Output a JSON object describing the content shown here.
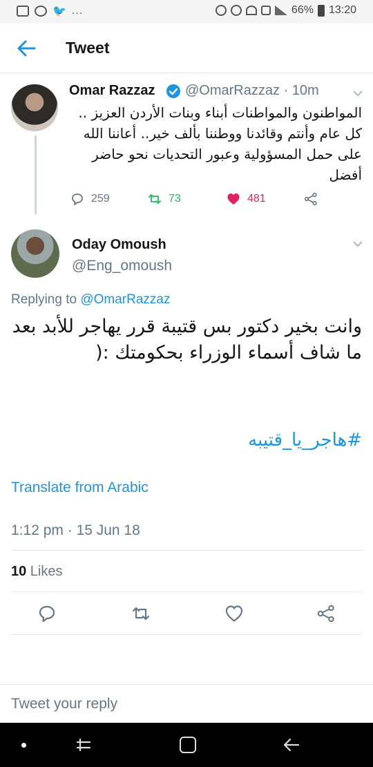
{
  "status_bar": {
    "battery": "66%",
    "time": "13:20",
    "overflow": "..."
  },
  "header": {
    "title": "Tweet",
    "back_icon": "arrow-left-icon"
  },
  "parent_tweet": {
    "name": "Omar Razzaz",
    "handle_time": "@OmarRazzaz · 10m",
    "text": "المواطنون والمواطنات أبناء وبنات الأردن العزيز .. كل عام وأنتم وقائدنا ووطننا بألف خير.. أعاننا الله على حمل المسؤولية وعبور التحديات نحو حاضر أفضل",
    "replies": "259",
    "retweets": "73",
    "likes": "481"
  },
  "tweet": {
    "name": "Oday Omoush",
    "handle": "@Eng_omoush",
    "replying_prefix": "Replying to ",
    "replying_to": "@OmarRazzaz",
    "text": "وانت بخير دكتور بس قتيبة قرر يهاجر للأبد بعد ما شاف أسماء الوزراء بحكومتك :(",
    "hashtag": "#هاجر_يا_قتيبه",
    "translate": "Translate from Arabic",
    "timestamp": "1:12 pm · 15 Jun 18",
    "likes_count": "10",
    "likes_label": " Likes"
  },
  "reply_box": {
    "placeholder": "Tweet your reply"
  },
  "colors": {
    "accent": "#1b95e0",
    "retweet": "#17bf63",
    "like": "#e0245e",
    "muted": "#657786"
  }
}
